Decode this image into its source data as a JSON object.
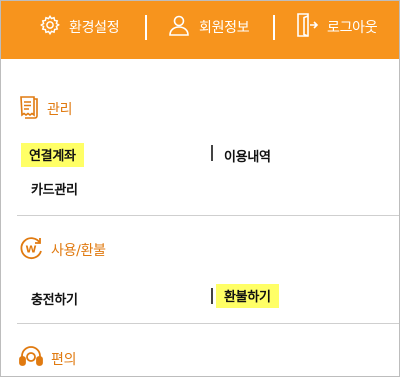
{
  "header": {
    "settings_label": "환경설정",
    "member_label": "회원정보",
    "logout_label": "로그아웃"
  },
  "sections": {
    "manage": {
      "title": "관리",
      "items": [
        "연결계좌",
        "이용내역",
        "카드관리"
      ]
    },
    "usage": {
      "title": "사용/환불",
      "items": [
        "충전하기",
        "환불하기"
      ]
    },
    "convenience": {
      "title": "편의"
    }
  },
  "colors": {
    "accent": "#f7941d",
    "highlight": "#ffff66",
    "icon_orange": "#e07a10"
  }
}
